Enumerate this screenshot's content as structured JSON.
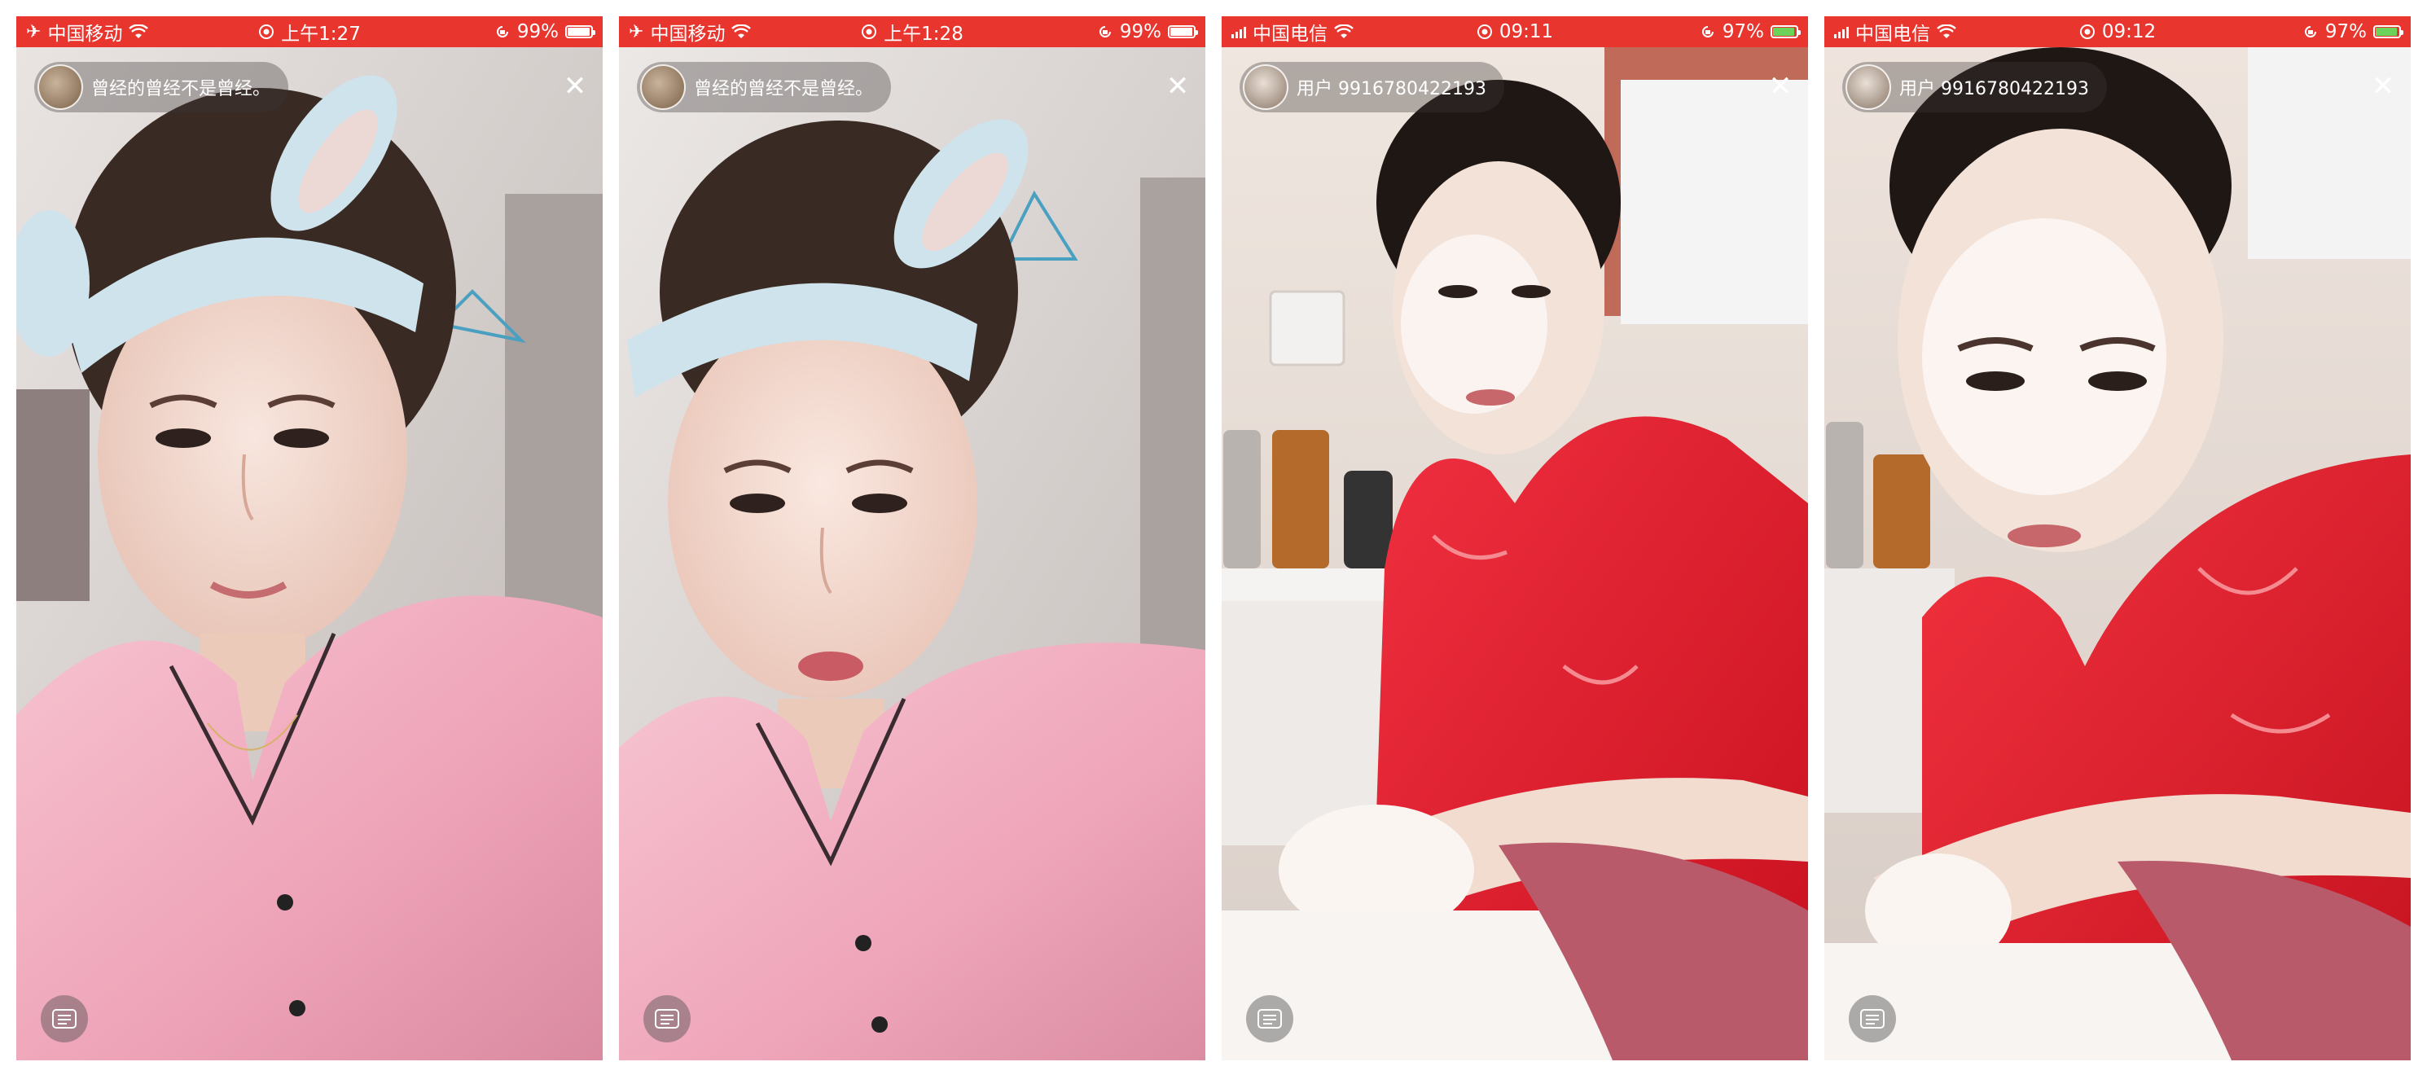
{
  "panels": [
    {
      "status": {
        "carrier": "中国移动",
        "time": "上午1:27",
        "battery": "99%",
        "network_icon": "airplane-icon"
      },
      "user": {
        "name": "曾经的曾经不是曾经。",
        "avatar_icon": "avatar-photo"
      },
      "close_icon": "close-icon",
      "menu_icon": "menu-icon",
      "scene": "pink-pajamas-headband"
    },
    {
      "status": {
        "carrier": "中国移动",
        "time": "上午1:28",
        "battery": "99%",
        "network_icon": "airplane-icon"
      },
      "user": {
        "name": "曾经的曾经不是曾经。",
        "avatar_icon": "avatar-photo"
      },
      "close_icon": "close-icon",
      "menu_icon": "menu-icon",
      "scene": "pink-pajamas-headband"
    },
    {
      "status": {
        "carrier": "中国电信",
        "time": "09:11",
        "battery": "97%",
        "network_icon": "signal-icon"
      },
      "user": {
        "name": "用户 9916780422193",
        "avatar_icon": "avatar-photo"
      },
      "close_icon": "close-icon",
      "menu_icon": "menu-icon",
      "scene": "red-robe-face-wash"
    },
    {
      "status": {
        "carrier": "中国电信",
        "time": "09:12",
        "battery": "97%",
        "network_icon": "signal-icon"
      },
      "user": {
        "name": "用户 9916780422193",
        "avatar_icon": "avatar-photo"
      },
      "close_icon": "close-icon",
      "menu_icon": "menu-icon",
      "scene": "red-robe-face-wash"
    }
  ],
  "colors": {
    "status_bar": "#e8362f",
    "overlay_text": "#ffffff",
    "pajamas_pink": "#f3b3c4",
    "robe_red": "#e21f2d",
    "headband_blue": "#cfe3ec"
  }
}
